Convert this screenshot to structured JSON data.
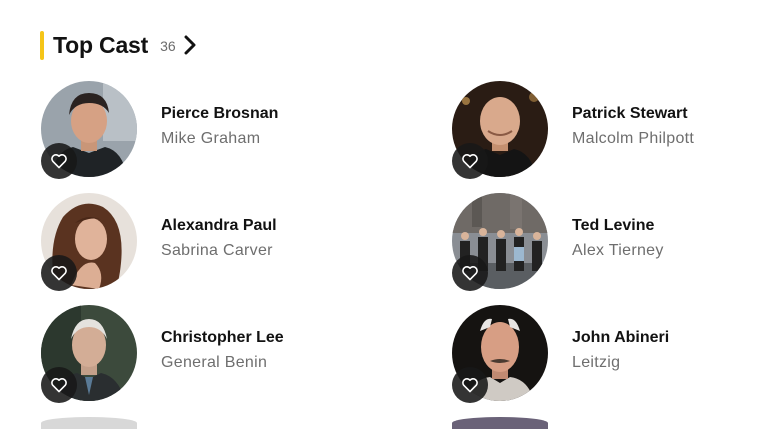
{
  "section": {
    "title": "Top Cast",
    "count": "36",
    "accent_color": "#f5c518"
  },
  "cast": [
    {
      "actor": "Pierce Brosnan",
      "character": "Mike Graham"
    },
    {
      "actor": "Patrick Stewart",
      "character": "Malcolm Philpott"
    },
    {
      "actor": "Alexandra Paul",
      "character": "Sabrina Carver"
    },
    {
      "actor": "Ted Levine",
      "character": "Alex Tierney"
    },
    {
      "actor": "Christopher Lee",
      "character": "General Benin"
    },
    {
      "actor": "John Abineri",
      "character": "Leitzig"
    }
  ],
  "icons": {
    "next": "chevron-right-icon",
    "favorite": "heart-outline-icon"
  }
}
